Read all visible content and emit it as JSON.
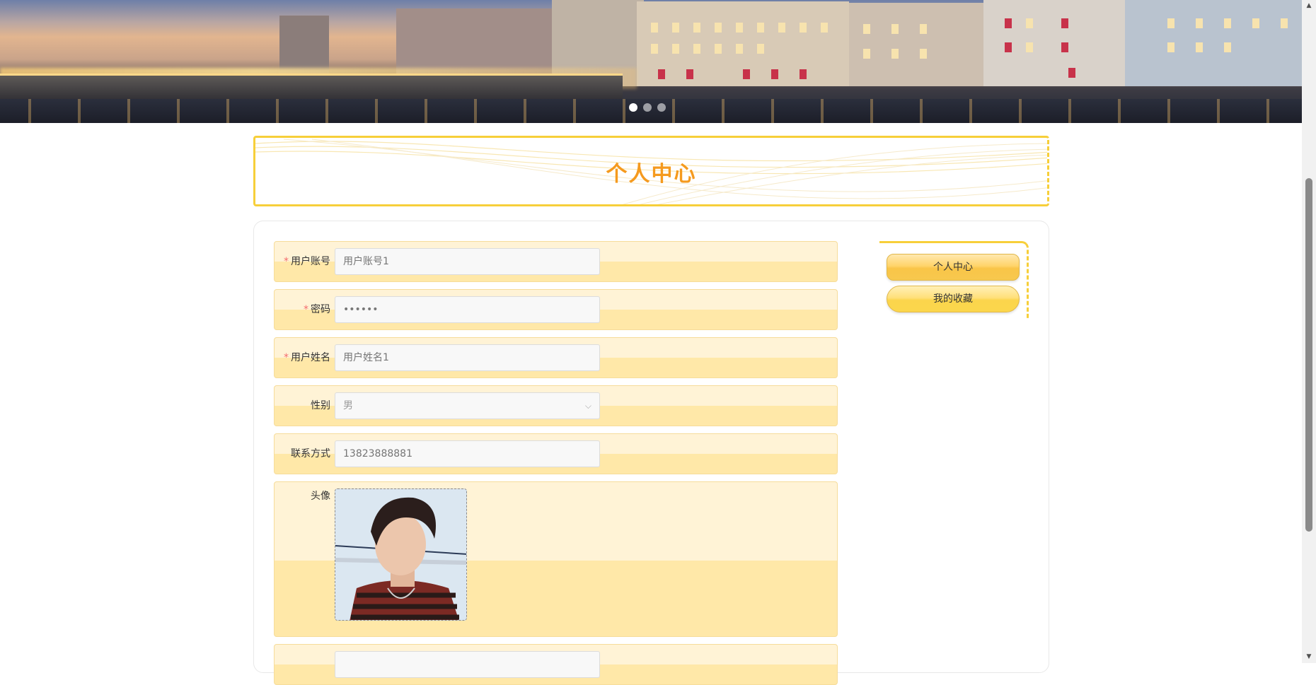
{
  "banner": {
    "slides_total": 3,
    "active_slide": 1
  },
  "page_title": "个人中心",
  "form": {
    "account_label": "用户账号",
    "account_placeholder": "用户账号1",
    "password_label": "密码",
    "password_value": "••••••",
    "name_label": "用户姓名",
    "name_placeholder": "用户姓名1",
    "gender_label": "性别",
    "gender_value": "男",
    "contact_label": "联系方式",
    "contact_placeholder": "13823888881",
    "avatar_label": "头像",
    "next_label": "",
    "required_mark": "*"
  },
  "side_menu": {
    "items": [
      {
        "label": "个人中心",
        "active": true
      },
      {
        "label": "我的收藏",
        "active": false
      }
    ]
  },
  "colors": {
    "accent_orange": "#f59a1e",
    "border_yellow": "#f7cf3a",
    "row_light": "#fff3d6",
    "row_dark": "#ffe8a8"
  }
}
